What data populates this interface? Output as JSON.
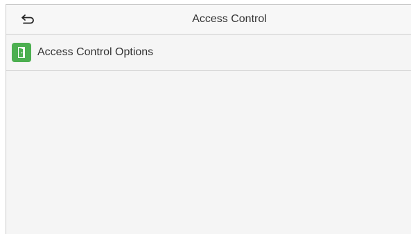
{
  "header": {
    "title": "Access Control",
    "back_icon": "back-arrow-icon"
  },
  "menu": {
    "items": [
      {
        "label": "Access Control Options",
        "icon": "door-icon",
        "icon_color": "#4caf50"
      }
    ]
  }
}
